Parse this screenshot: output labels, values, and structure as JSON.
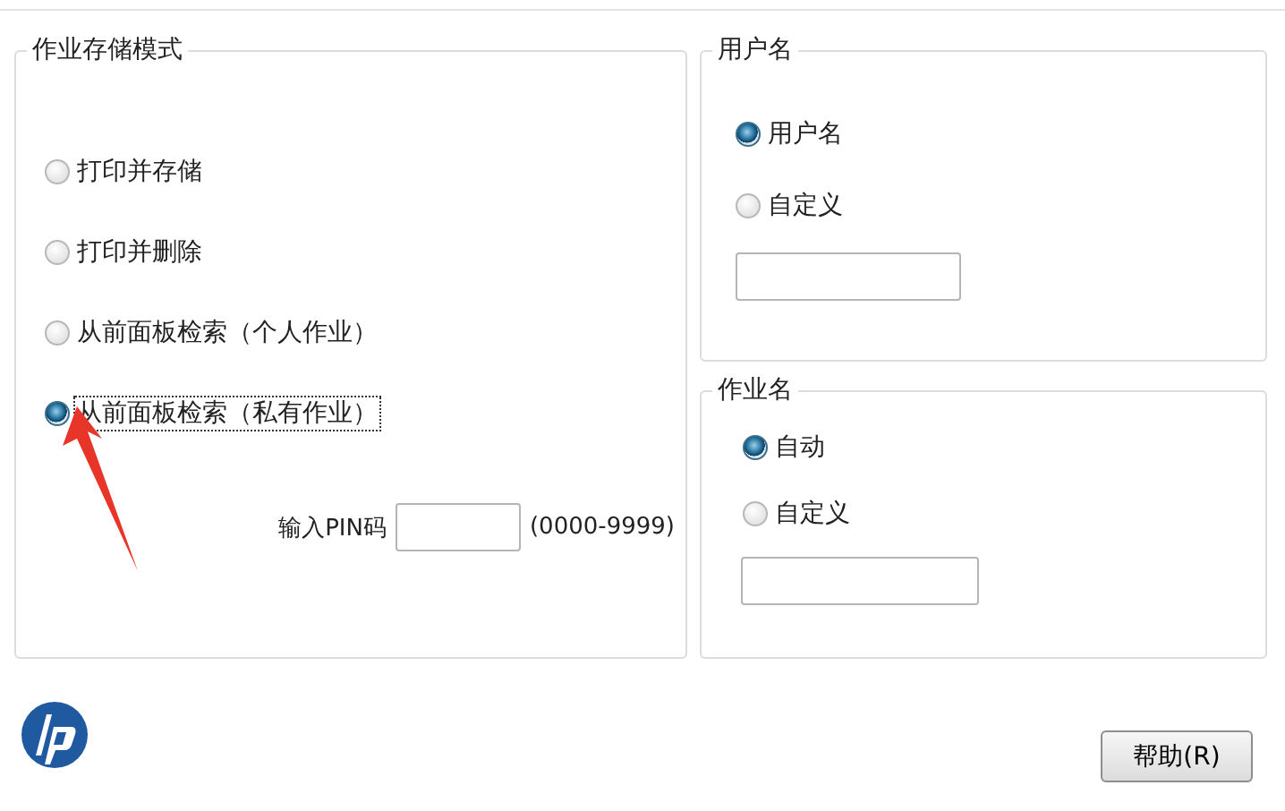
{
  "storage_mode": {
    "title": "作业存储模式",
    "options": [
      {
        "label": "打印并存储",
        "selected": false,
        "focused": false
      },
      {
        "label": "打印并删除",
        "selected": false,
        "focused": false
      },
      {
        "label": "从前面板检索（个人作业）",
        "selected": false,
        "focused": false
      },
      {
        "label": "从前面板检索（私有作业）",
        "selected": true,
        "focused": true
      }
    ],
    "pin": {
      "label": "输入PIN码",
      "hint": "(0000-9999)"
    }
  },
  "user_name": {
    "title": "用户名",
    "options": [
      {
        "label": "用户名",
        "selected": true
      },
      {
        "label": "自定义",
        "selected": false
      }
    ]
  },
  "job_name": {
    "title": "作业名",
    "options": [
      {
        "label": "自动",
        "selected": true
      },
      {
        "label": "自定义",
        "selected": false
      }
    ]
  },
  "help_button": "帮助(R)"
}
